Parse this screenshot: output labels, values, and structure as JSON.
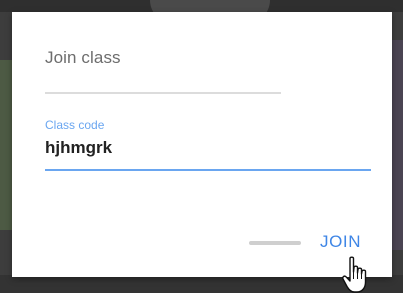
{
  "dialog": {
    "title": "Join class",
    "field": {
      "label": "Class code",
      "value": "hjhmgrk",
      "accent_color": "#6aa6f0"
    },
    "actions": {
      "join_label": "JOIN",
      "join_color": "#3f86e6"
    }
  },
  "icons": {
    "cursor": "hand-pointer-icon"
  }
}
